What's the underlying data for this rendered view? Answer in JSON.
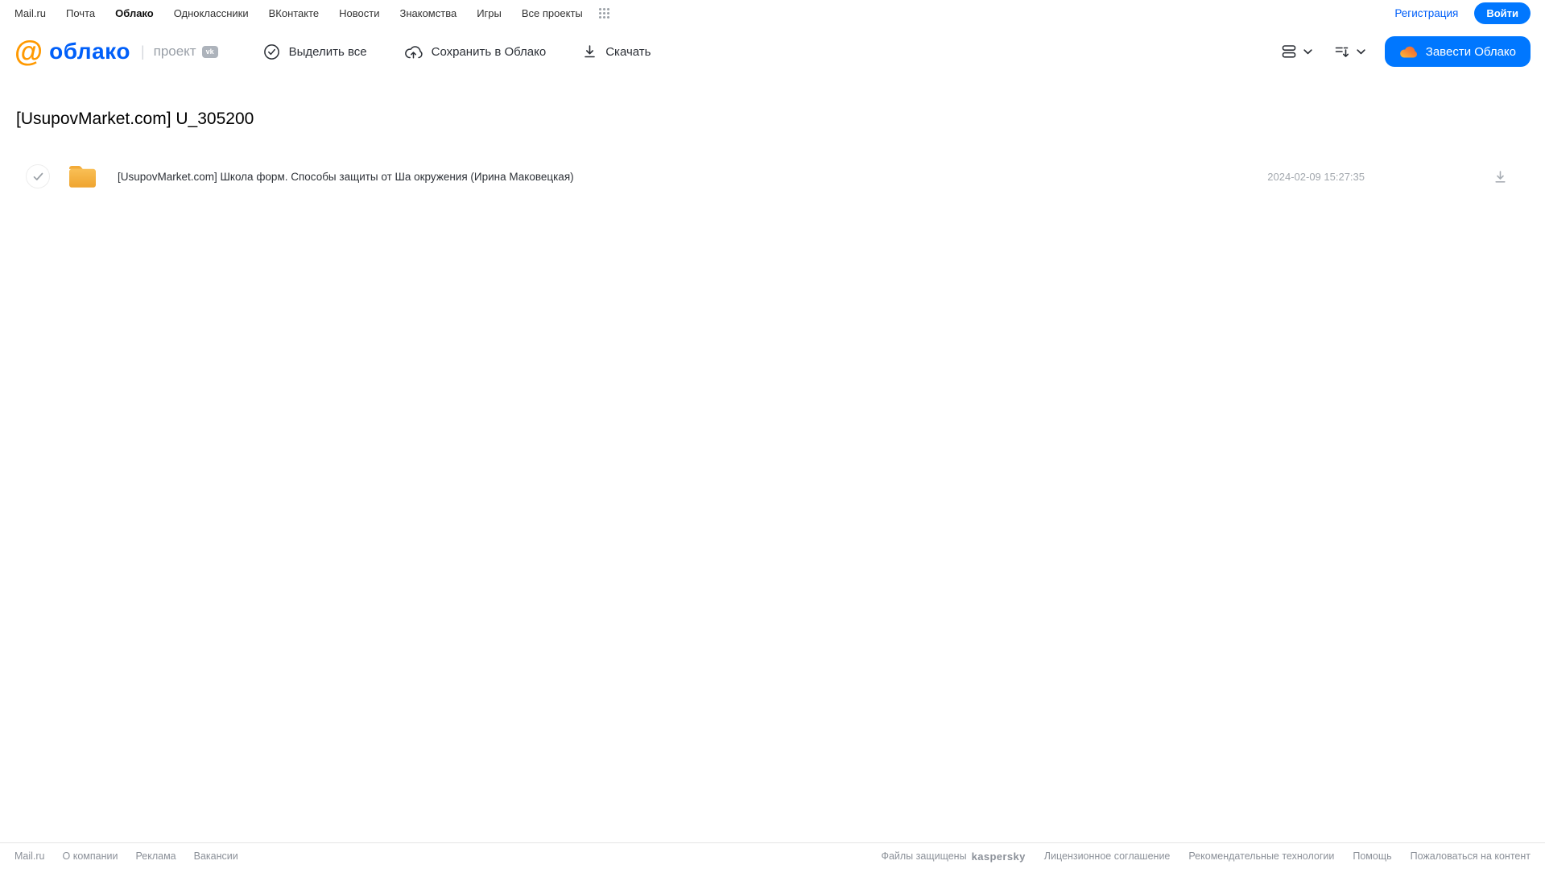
{
  "topnav": {
    "items": [
      {
        "label": "Mail.ru"
      },
      {
        "label": "Почта"
      },
      {
        "label": "Облако"
      },
      {
        "label": "Одноклассники"
      },
      {
        "label": "ВКонтакте"
      },
      {
        "label": "Новости"
      },
      {
        "label": "Знакомства"
      },
      {
        "label": "Игры"
      },
      {
        "label": "Все проекты"
      }
    ],
    "registration_label": "Регистрация",
    "login_label": "Войти"
  },
  "header": {
    "logo_at": "@",
    "logo_text": "облако",
    "divider": "|",
    "project_label": "проект",
    "vk_badge": "vk",
    "toolbar": {
      "select_all_label": "Выделить все",
      "save_to_cloud_label": "Сохранить в Облако",
      "download_label": "Скачать"
    },
    "get_cloud_button_label": "Завести Облако"
  },
  "main": {
    "title": "[UsupovMarket.com] U_305200",
    "files": [
      {
        "type": "folder",
        "name": "[UsupovMarket.com] Школа форм. Способы защиты от Ша окружения (Ирина Маковецкая)",
        "date": "2024-02-09 15:27:35"
      }
    ]
  },
  "footer": {
    "left_links": [
      "Mail.ru",
      "О компании",
      "Реклама",
      "Вакансии"
    ],
    "protected_label": "Файлы защищены",
    "kaspersky_label": "kaspersky",
    "right_links": [
      "Лицензионное соглашение",
      "Рекомендательные технологии",
      "Помощь",
      "Пожаловаться на контент"
    ]
  },
  "colors": {
    "accent_blue": "#0077ff",
    "link_blue": "#005ff9",
    "logo_orange": "#ff9900",
    "folder_yellow_light": "#f9bc4f",
    "folder_yellow_dark": "#efa42f",
    "kaspersky_green": "#00a88e",
    "muted_gray": "#a3a8ae"
  }
}
